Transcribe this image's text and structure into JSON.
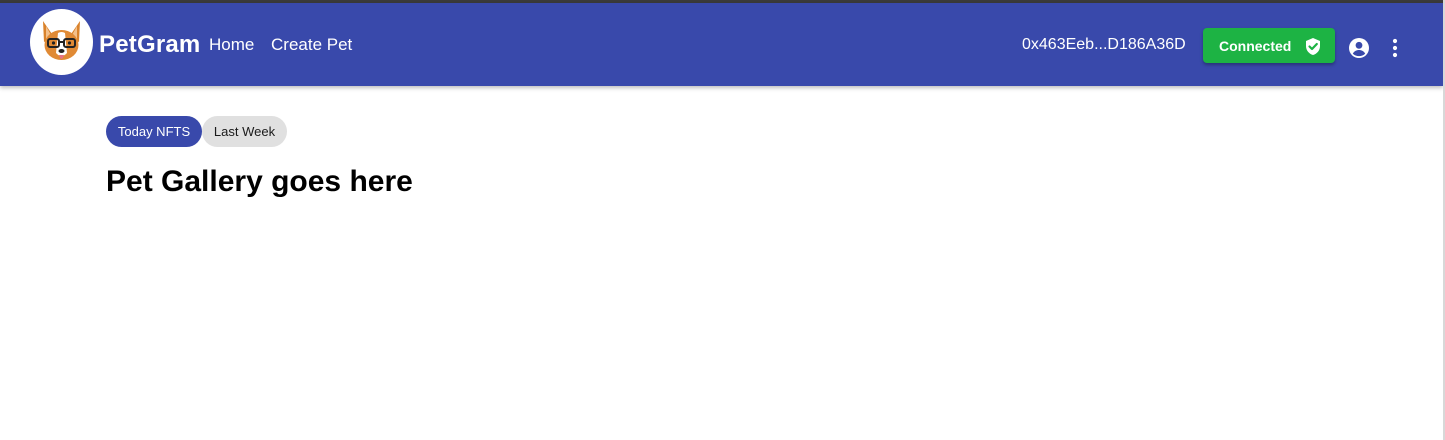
{
  "header": {
    "brand": "PetGram",
    "nav": [
      {
        "label": "Home"
      },
      {
        "label": "Create Pet"
      }
    ],
    "wallet_address": "0x463Eeb...D186A36D",
    "connected_label": "Connected",
    "icons": {
      "logo": "corgi-with-glasses-logo",
      "status": "shield-check-icon",
      "account": "account-circle-icon",
      "menu": "more-vertical-icon"
    }
  },
  "filters": [
    {
      "label": "Today NFTS",
      "selected": true
    },
    {
      "label": "Last Week",
      "selected": false
    }
  ],
  "main": {
    "heading": "Pet Gallery goes here"
  },
  "colors": {
    "appbar": "#3949ab",
    "connected": "#1db344",
    "chip_selected": "#3949ab",
    "chip_unselected": "#e0e0e0"
  }
}
